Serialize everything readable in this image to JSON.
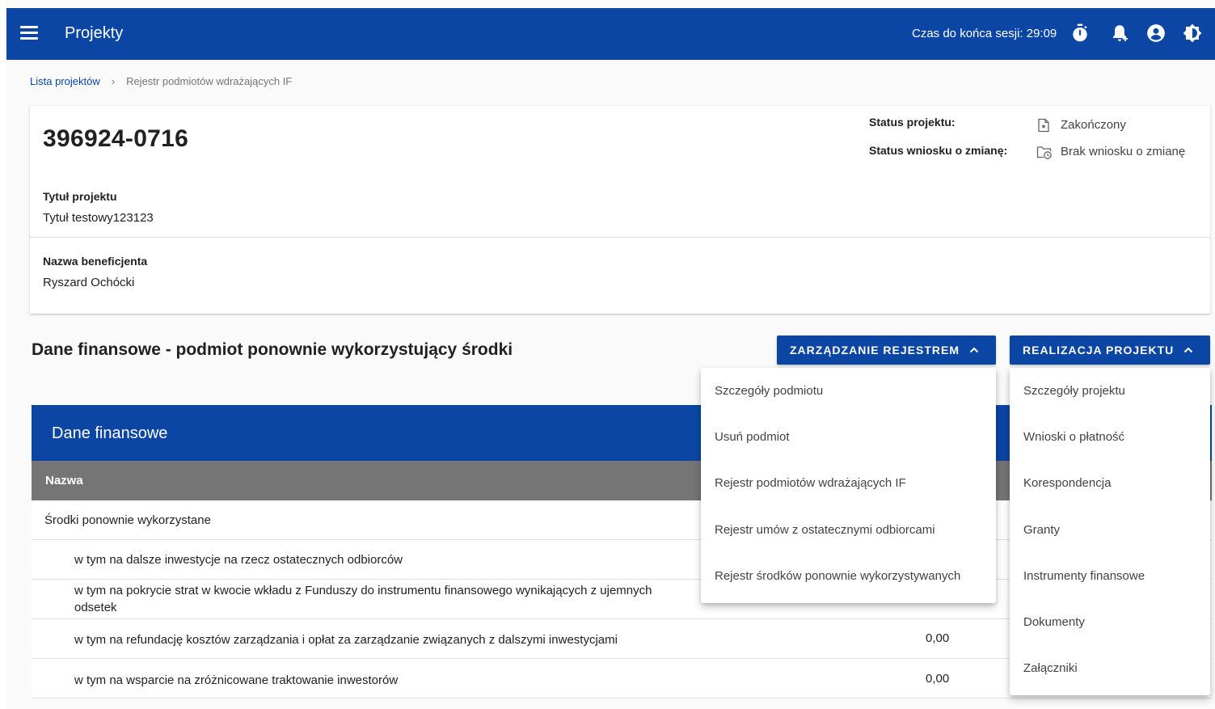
{
  "header": {
    "title": "Projekty",
    "session_label": "Czas do końca sesji: 29:09"
  },
  "breadcrumb": {
    "parent": "Lista projektów",
    "separator": "›",
    "current": "Rejestr podmiotów wdrażających IF"
  },
  "project": {
    "number": "396924-0716",
    "status_label": "Status projektu:",
    "status_value": "Zakończony",
    "change_status_label": "Status wniosku o zmianę:",
    "change_status_value": "Brak wniosku o zmianę",
    "title_label": "Tytuł projektu",
    "title_value": "Tytuł testowy123123",
    "beneficiary_label": "Nazwa beneficjenta",
    "beneficiary_value": "Ryszard Ochócki"
  },
  "section": {
    "title": "Dane finansowe - podmiot ponownie wykorzystujący środki",
    "btn_register": "ZARZĄDZANIE REJESTREM",
    "btn_realization": "REALIZACJA PROJEKTU"
  },
  "table": {
    "title": "Dane finansowe",
    "column_name": "Nazwa",
    "rows": [
      {
        "label": "Środki ponownie wykorzystane",
        "value": ""
      },
      {
        "label": "w tym na dalsze inwestycje na rzecz ostatecznych odbiorców",
        "value": ""
      },
      {
        "label": "w tym na pokrycie strat w kwocie wkładu z Funduszy do instrumentu finansowego wynikających z ujemnych odsetek",
        "value": ""
      },
      {
        "label": "w tym na refundację kosztów zarządzania i opłat za zarządzanie związanych z dalszymi inwestycjami",
        "value": "0,00"
      },
      {
        "label": "w tym na wsparcie na zróżnicowane traktowanie inwestorów",
        "value": "0,00"
      }
    ]
  },
  "register_menu": [
    "Szczegóły podmiotu",
    "Usuń podmiot",
    "Rejestr podmiotów wdrażających IF",
    "Rejestr umów z ostatecznymi odbiorcami",
    "Rejestr środków ponownie wykorzystywanych"
  ],
  "realization_menu": [
    "Szczegóły projektu",
    "Wnioski o płatność",
    "Korespondencja",
    "Granty",
    "Instrumenty finansowe",
    "Dokumenty",
    "Załączniki"
  ],
  "colors": {
    "primary": "#0b46a4",
    "table_column_header": "#757575"
  }
}
